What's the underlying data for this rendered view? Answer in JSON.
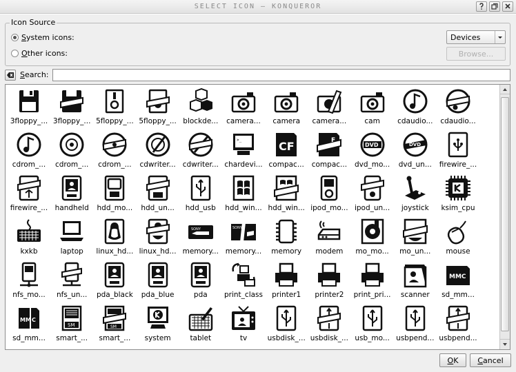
{
  "window": {
    "title": "SELECT ICON – KONQUEROR"
  },
  "source": {
    "legend": "Icon Source",
    "system_label": "ystem icons:",
    "system_mnemonic": "S",
    "other_label": "ther icons:",
    "other_mnemonic": "O",
    "selected": "system"
  },
  "category": {
    "selected": "Devices"
  },
  "browse_label": "Browse...",
  "search": {
    "label_mnemonic": "S",
    "label": "earch:",
    "value": ""
  },
  "icons": [
    {
      "label": "3floppy_...",
      "icon": "floppy"
    },
    {
      "label": "3floppy_...",
      "icon": "floppy-mount"
    },
    {
      "label": "5floppy_...",
      "icon": "floppy5"
    },
    {
      "label": "5floppy_...",
      "icon": "floppy5-mount"
    },
    {
      "label": "blockde...",
      "icon": "blocks"
    },
    {
      "label": "camera...",
      "icon": "camera"
    },
    {
      "label": "camera",
      "icon": "camera"
    },
    {
      "label": "camera...",
      "icon": "camera-mount"
    },
    {
      "label": "cam",
      "icon": "camera"
    },
    {
      "label": "cdaudio...",
      "icon": "cdaudio"
    },
    {
      "label": "cdaudio...",
      "icon": "cdaudio-mount"
    },
    {
      "label": "cdrom_...",
      "icon": "cdaudio"
    },
    {
      "label": "cdrom_...",
      "icon": "disc"
    },
    {
      "label": "cdrom_...",
      "icon": "disc-mount"
    },
    {
      "label": "cdwriter...",
      "icon": "cdwriter"
    },
    {
      "label": "cdwriter...",
      "icon": "cdwriter-mount"
    },
    {
      "label": "chardevi...",
      "icon": "monitor"
    },
    {
      "label": "compac...",
      "icon": "cf"
    },
    {
      "label": "compac...",
      "icon": "cf-mount"
    },
    {
      "label": "dvd_mo...",
      "icon": "dvd"
    },
    {
      "label": "dvd_un...",
      "icon": "dvd-mount"
    },
    {
      "label": "firewire_...",
      "icon": "firewire"
    },
    {
      "label": "firewire_...",
      "icon": "firewire-mount"
    },
    {
      "label": "handheld",
      "icon": "handheld"
    },
    {
      "label": "hdd_mo...",
      "icon": "hdd"
    },
    {
      "label": "hdd_un...",
      "icon": "hdd-mount"
    },
    {
      "label": "hdd_usb",
      "icon": "usb-stick"
    },
    {
      "label": "hdd_win...",
      "icon": "windows"
    },
    {
      "label": "hdd_win...",
      "icon": "windows-mount"
    },
    {
      "label": "ipod_mo...",
      "icon": "ipod"
    },
    {
      "label": "ipod_un...",
      "icon": "ipod-mount"
    },
    {
      "label": "joystick",
      "icon": "joystick"
    },
    {
      "label": "ksim_cpu",
      "icon": "cpu"
    },
    {
      "label": "kxkb",
      "icon": "keyboard"
    },
    {
      "label": "laptop",
      "icon": "laptop"
    },
    {
      "label": "linux_hd...",
      "icon": "linux"
    },
    {
      "label": "linux_hd...",
      "icon": "linux-mount"
    },
    {
      "label": "memory...",
      "icon": "memstick"
    },
    {
      "label": "memory...",
      "icon": "memstick-mount"
    },
    {
      "label": "memory",
      "icon": "chip"
    },
    {
      "label": "modem",
      "icon": "modem"
    },
    {
      "label": "mo_mo...",
      "icon": "mo"
    },
    {
      "label": "mo_un...",
      "icon": "mo-mount"
    },
    {
      "label": "mouse",
      "icon": "mouse"
    },
    {
      "label": "nfs_mo...",
      "icon": "nfs"
    },
    {
      "label": "nfs_un...",
      "icon": "nfs-mount"
    },
    {
      "label": "pda_black",
      "icon": "handheld"
    },
    {
      "label": "pda_blue",
      "icon": "handheld"
    },
    {
      "label": "pda",
      "icon": "handheld"
    },
    {
      "label": "print_class",
      "icon": "print-class"
    },
    {
      "label": "printer1",
      "icon": "printer"
    },
    {
      "label": "printer2",
      "icon": "printer"
    },
    {
      "label": "print_pri...",
      "icon": "printer"
    },
    {
      "label": "scanner",
      "icon": "scanner"
    },
    {
      "label": "sd_mm...",
      "icon": "mmc"
    },
    {
      "label": "sd_mm...",
      "icon": "mmc-mount"
    },
    {
      "label": "smart_...",
      "icon": "smartmedia"
    },
    {
      "label": "smart_...",
      "icon": "smartmedia-mount"
    },
    {
      "label": "system",
      "icon": "system"
    },
    {
      "label": "tablet",
      "icon": "tablet"
    },
    {
      "label": "tv",
      "icon": "tv"
    },
    {
      "label": "usbdisk_...",
      "icon": "usb-stick"
    },
    {
      "label": "usbdisk_...",
      "icon": "usb-stick-mount"
    },
    {
      "label": "usb_mo...",
      "icon": "usb-stick"
    },
    {
      "label": "usbpend...",
      "icon": "usb-stick"
    },
    {
      "label": "usbpend...",
      "icon": "usb-stick-mount"
    }
  ],
  "ok_mnemonic": "O",
  "ok_label": "K",
  "cancel_mnemonic": "C",
  "cancel_label": "ancel"
}
